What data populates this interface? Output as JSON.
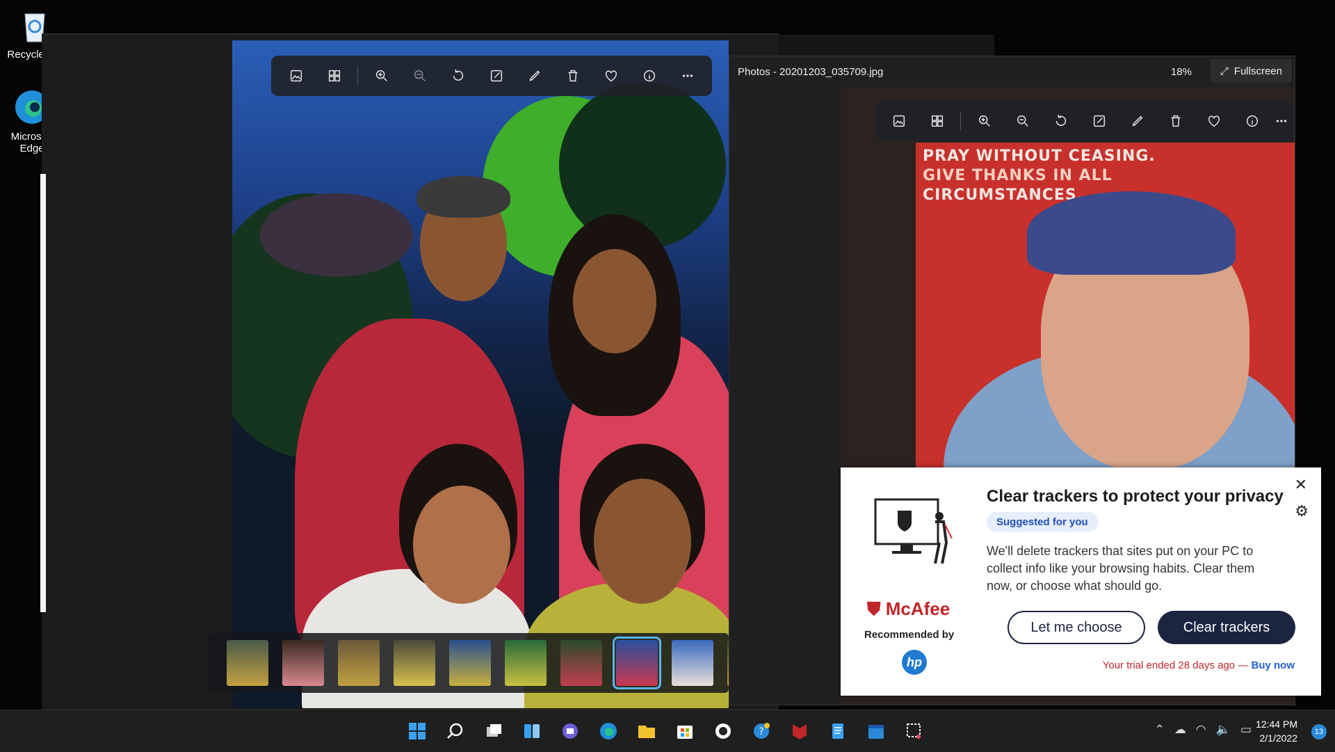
{
  "desktop": {
    "icons": [
      {
        "label": "Recycle Bin",
        "icon": "recycle-bin-icon"
      },
      {
        "label": "Microsoft Edge",
        "icon": "edge-icon"
      }
    ]
  },
  "viewer_main": {
    "toolbar": [
      "image-icon",
      "gallery-icon",
      "zoom-in-icon",
      "zoom-out-icon",
      "rotate-icon",
      "edit-icon",
      "draw-icon",
      "delete-icon",
      "favorite-icon",
      "info-icon",
      "more-icon"
    ],
    "filmstrip": {
      "count": 10,
      "selected_index": 7
    }
  },
  "photos_window": {
    "title": "Photos - 20201203_035709.jpg",
    "zoom": "18%",
    "fullscreen_label": "Fullscreen",
    "photo_text": [
      "PRAY WITHOUT CEASING.",
      "GIVE THANKS  IN ALL",
      "CIRCUMSTANCES."
    ]
  },
  "mcafee": {
    "title": "Clear trackers to protect your privacy",
    "badge": "Suggested for you",
    "body": "We'll delete trackers that sites put on your PC to collect info like your browsing habits. Clear them now, or choose what should go.",
    "btn_choose": "Let me choose",
    "btn_clear": "Clear trackers",
    "trial_text": "Your trial ended 28 days ago",
    "trial_sep": "—",
    "buy_now": "Buy now",
    "logo_text": "McAfee",
    "recommended_by": "Recommended by",
    "partner": "hp"
  },
  "taskbar": {
    "apps": [
      "windows-start-icon",
      "search-icon",
      "task-view-icon",
      "widgets-icon",
      "teams-chat-icon",
      "edge-icon",
      "file-explorer-icon",
      "store-icon",
      "app-circle-icon",
      "help-icon",
      "mcafee-icon",
      "notepad-icon",
      "calendar-icon",
      "snipping-tool-icon"
    ],
    "time": "12:44 PM",
    "date": "2/1/2022",
    "notifications": "13",
    "accent": "#2a8ad8"
  }
}
